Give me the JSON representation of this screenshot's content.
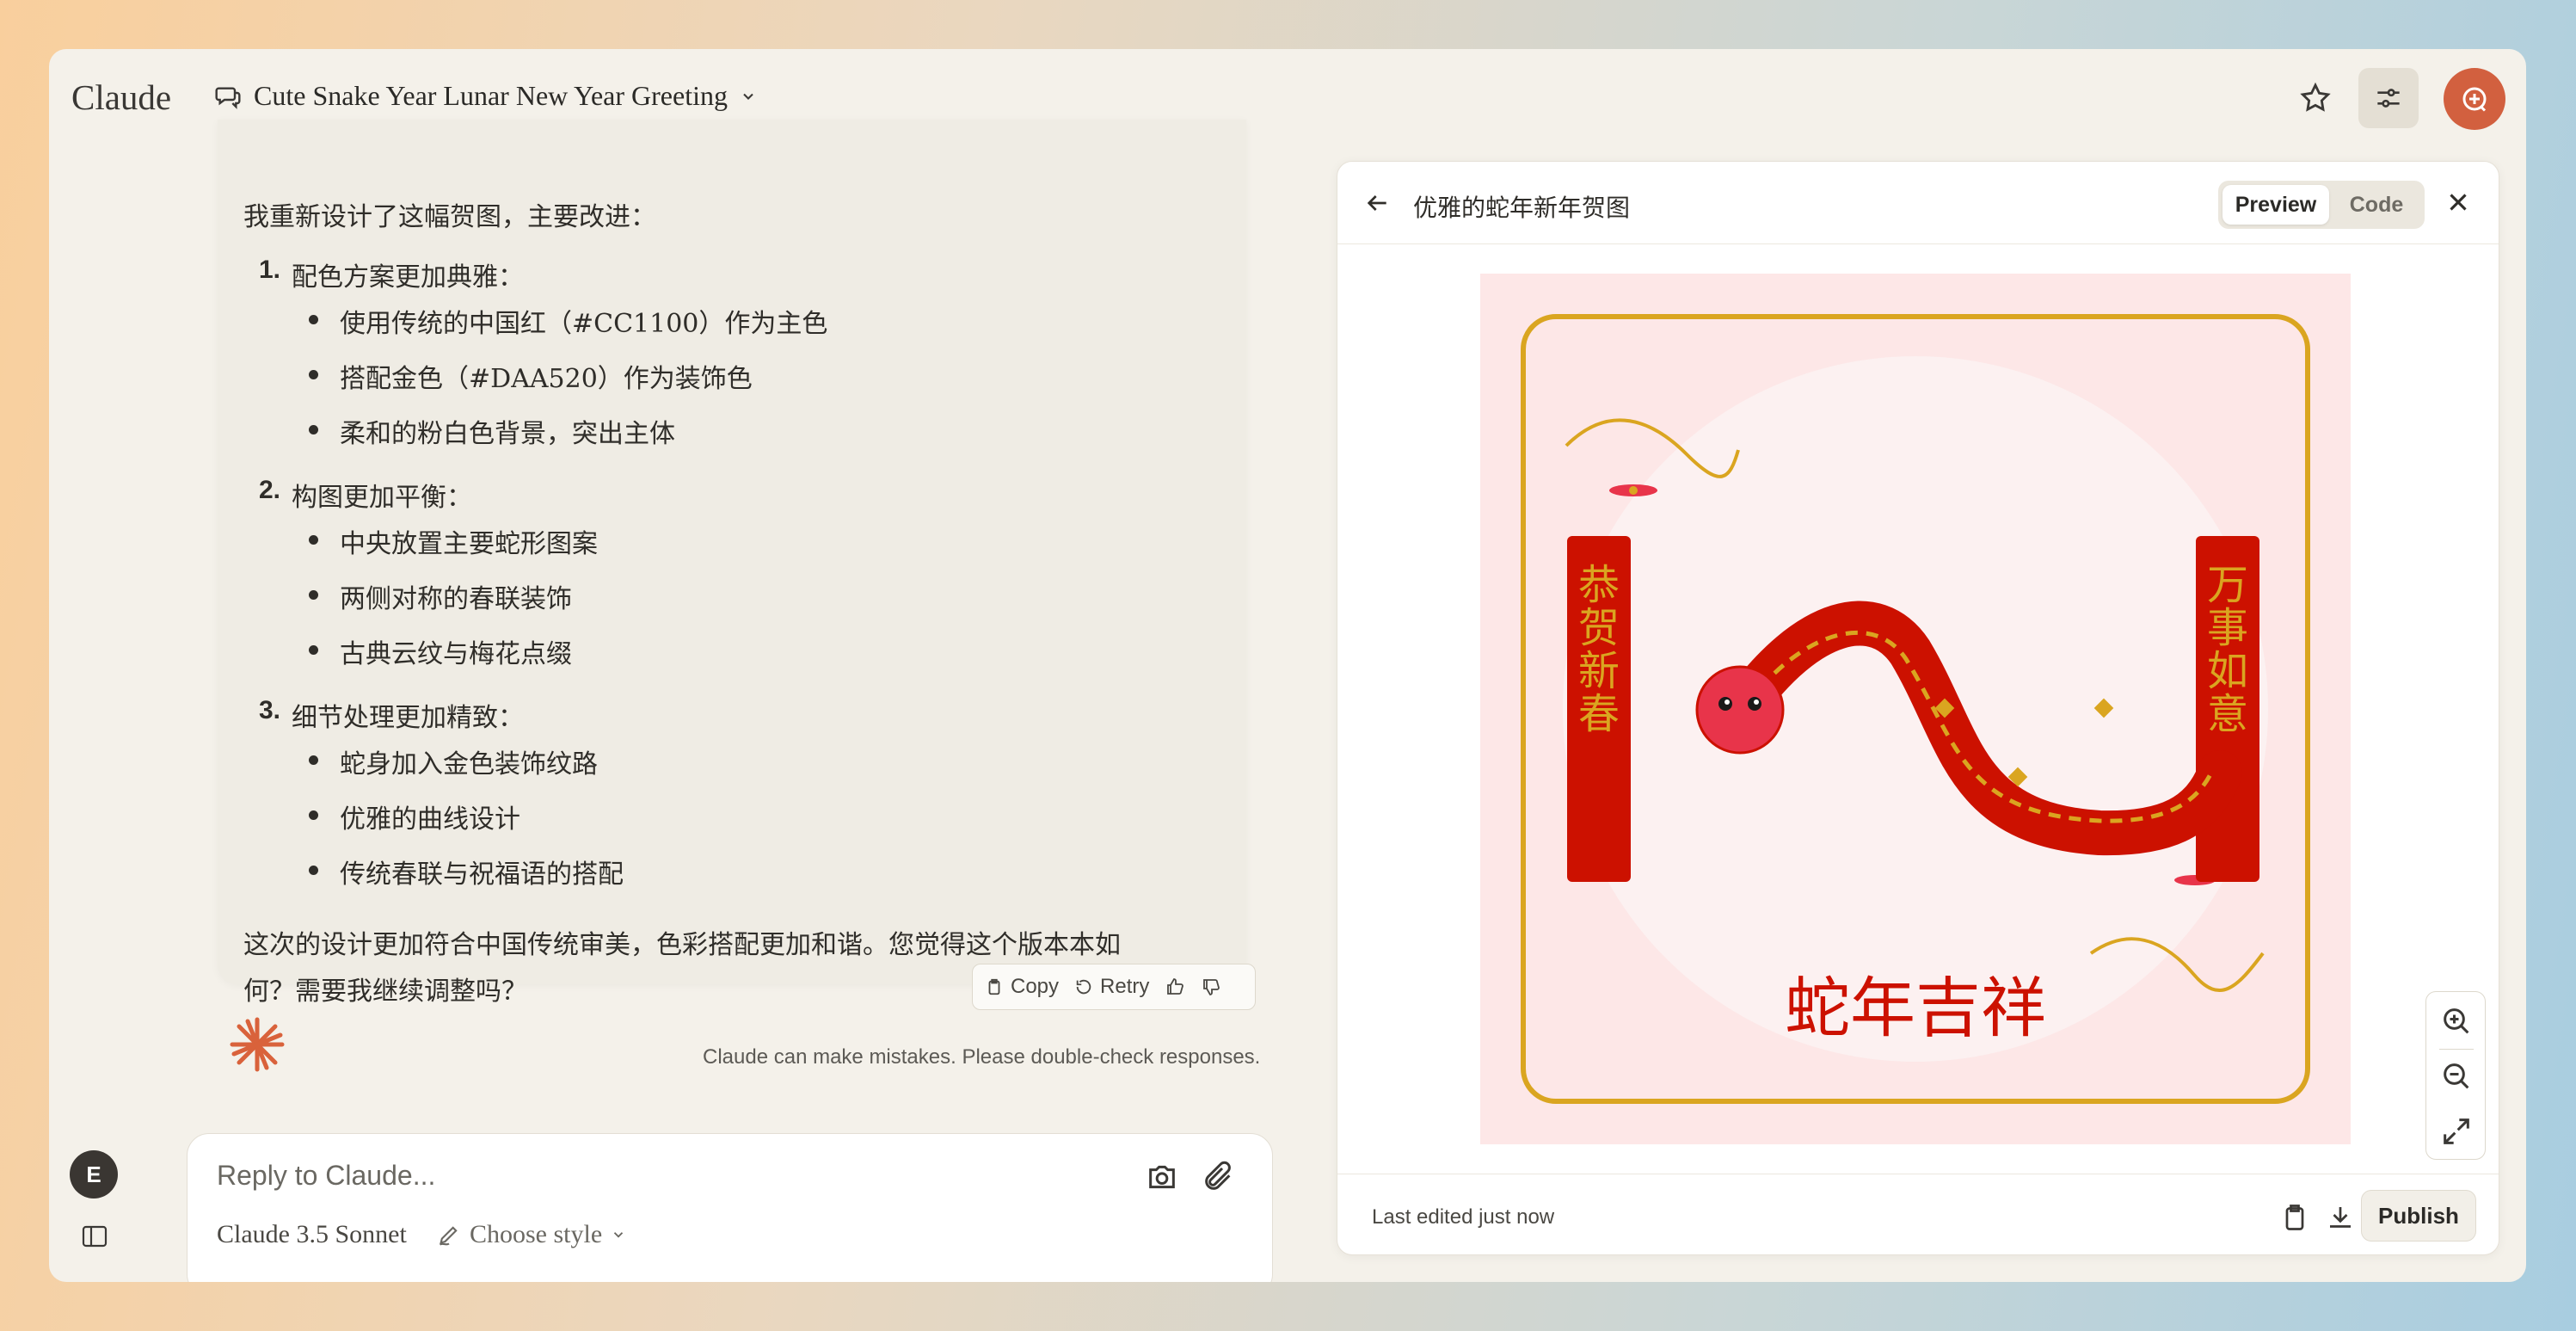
{
  "app": {
    "logo": "Claude"
  },
  "header": {
    "chat_title": "Cute Snake Year Lunar New Year Greeting"
  },
  "message": {
    "intro": "我重新设计了这幅贺图，主要改进：",
    "sections": [
      {
        "num": "1.",
        "title": "配色方案更加典雅：",
        "items": [
          "使用传统的中国红（#CC1100）作为主色",
          "搭配金色（#DAA520）作为装饰色",
          "柔和的粉白色背景，突出主体"
        ]
      },
      {
        "num": "2.",
        "title": "构图更加平衡：",
        "items": [
          "中央放置主要蛇形图案",
          "两侧对称的春联装饰",
          "古典云纹与梅花点缀"
        ]
      },
      {
        "num": "3.",
        "title": "细节处理更加精致：",
        "items": [
          "蛇身加入金色装饰纹路",
          "优雅的曲线设计",
          "传统春联与祝福语的搭配"
        ]
      }
    ],
    "outro_1": "这次的设计更加符合中国传统审美，色彩搭配更加和谐。您觉得这个版本本如",
    "outro_2": "何？需要我继续调整吗？"
  },
  "actions": {
    "copy": "Copy",
    "retry": "Retry"
  },
  "disclaimer": "Claude can make mistakes. Please double-check responses.",
  "input": {
    "placeholder": "Reply to Claude...",
    "model": "Claude 3.5 Sonnet",
    "style": "Choose style"
  },
  "user": {
    "initial": "E"
  },
  "artifact": {
    "title": "优雅的蛇年新年贺图",
    "tabs": {
      "preview": "Preview",
      "code": "Code"
    },
    "couplet_left": "恭贺新春",
    "couplet_right": "万事如意",
    "greeting": "蛇年吉祥",
    "colors": {
      "red": "#CC1100",
      "gold": "#DAA520",
      "background": "#FDE7E7"
    }
  },
  "footer": {
    "edited": "Last edited just now",
    "publish": "Publish"
  }
}
